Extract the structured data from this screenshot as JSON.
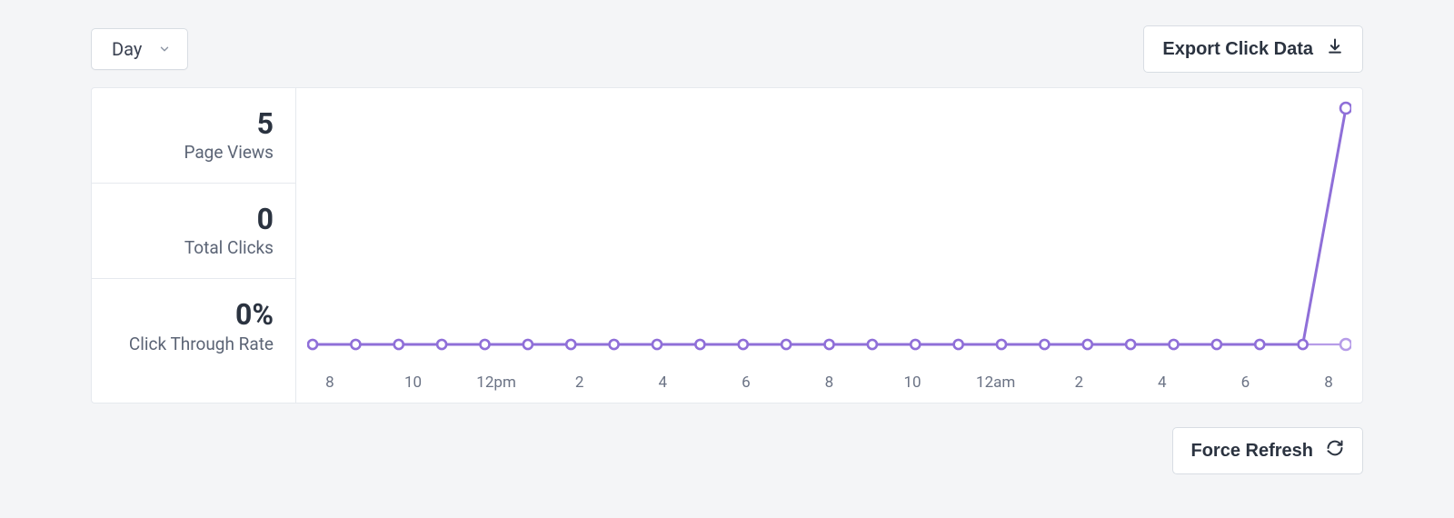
{
  "toolbar": {
    "range_selected": "Day",
    "export_label": "Export Click Data",
    "refresh_label": "Force Refresh"
  },
  "stats": {
    "page_views_value": "5",
    "page_views_label": "Page Views",
    "total_clicks_value": "0",
    "total_clicks_label": "Total Clicks",
    "ctr_value": "0%",
    "ctr_label": "Click Through Rate"
  },
  "colors": {
    "series_a": "#8f6fd8",
    "series_b": "#b69ce8",
    "axis_text": "#6b7385"
  },
  "chart_data": {
    "type": "line",
    "xlabel": "",
    "ylabel": "",
    "ylim": [
      0,
      5
    ],
    "categories": [
      "8",
      "",
      "10",
      "",
      "12pm",
      "",
      "2",
      "",
      "4",
      "",
      "6",
      "",
      "8",
      "",
      "10",
      "",
      "12am",
      "",
      "2",
      "",
      "4",
      "",
      "6",
      "",
      "8"
    ],
    "series": [
      {
        "name": "Page Views",
        "values": [
          0,
          0,
          0,
          0,
          0,
          0,
          0,
          0,
          0,
          0,
          0,
          0,
          0,
          0,
          0,
          0,
          0,
          0,
          0,
          0,
          0,
          0,
          0,
          0,
          5
        ]
      },
      {
        "name": "Total Clicks",
        "values": [
          0,
          0,
          0,
          0,
          0,
          0,
          0,
          0,
          0,
          0,
          0,
          0,
          0,
          0,
          0,
          0,
          0,
          0,
          0,
          0,
          0,
          0,
          0,
          0,
          0
        ]
      }
    ]
  }
}
